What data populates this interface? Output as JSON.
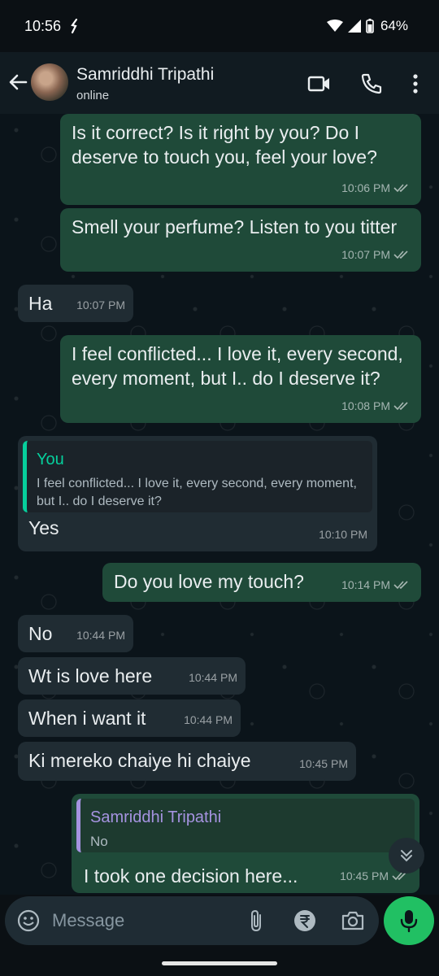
{
  "status_bar": {
    "time": "10:56",
    "battery": "64%"
  },
  "header": {
    "contact_name": "Samriddhi Tripathi",
    "status": "online"
  },
  "messages": [
    {
      "text": "Is it correct? Is it right by you? Do I deserve to touch you, feel your love?",
      "time": "10:06 PM"
    },
    {
      "text": "Smell your perfume? Listen to you titter",
      "time": "10:07 PM"
    },
    {
      "text": "Ha",
      "time": "10:07 PM"
    },
    {
      "text": "I feel conflicted... I love it, every second, every moment, but I.. do I deserve it?",
      "time": "10:08 PM"
    },
    {
      "quote_author": "You",
      "quote_text": "I feel conflicted... I love it, every second, every moment, but I.. do I deserve it?",
      "text": "Yes",
      "time": "10:10 PM"
    },
    {
      "text": "Do you love my touch?",
      "time": "10:14 PM"
    },
    {
      "text": "No",
      "time": "10:44 PM"
    },
    {
      "text": "Wt is love here",
      "time": "10:44 PM"
    },
    {
      "text": "When i want it",
      "time": "10:44 PM"
    },
    {
      "text": "Ki mereko chaiye hi chaiye",
      "time": "10:45 PM"
    },
    {
      "quote_author": "Samriddhi Tripathi",
      "quote_text": "No",
      "text": "I took one decision here...",
      "time": "10:45 PM"
    }
  ],
  "composer": {
    "placeholder": "Message"
  },
  "colors": {
    "outgoing_bubble": "#1f4a39",
    "incoming_bubble": "#202c33",
    "accent_green": "#21c063",
    "read_ticks": "#a8b8b3"
  },
  "icons": [
    "back-arrow-icon",
    "video-call-icon",
    "phone-icon",
    "more-options-icon",
    "emoji-icon",
    "attach-icon",
    "rupee-payment-icon",
    "camera-icon",
    "mic-icon",
    "scroll-down-icon"
  ]
}
